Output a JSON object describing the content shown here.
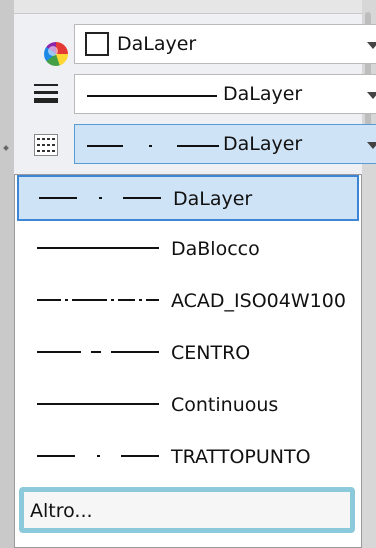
{
  "properties": {
    "color": {
      "value": "DaLayer",
      "icon": "color-wheel-icon",
      "swatch_color": "#ffffff"
    },
    "lineweight": {
      "value": "DaLayer",
      "icon": "lineweight-icon"
    },
    "linetype": {
      "value": "DaLayer",
      "icon": "linetype-icon"
    }
  },
  "linetype_list": {
    "items": [
      {
        "label": "DaLayer",
        "pattern": "dash-dot",
        "selected": true
      },
      {
        "label": "DaBlocco",
        "pattern": "continuous",
        "selected": false
      },
      {
        "label": "ACAD_ISO04W100",
        "pattern": "long-dash-dot",
        "selected": false
      },
      {
        "label": "CENTRO",
        "pattern": "center",
        "selected": false
      },
      {
        "label": "Continuous",
        "pattern": "continuous",
        "selected": false
      },
      {
        "label": "TRATTOPUNTO",
        "pattern": "dash-dot",
        "selected": false
      }
    ],
    "other_label": "Altro..."
  },
  "colors": {
    "selection_bg": "#cfe3f6",
    "selection_border": "#3d86d6",
    "highlight_border": "#8cc9da"
  }
}
